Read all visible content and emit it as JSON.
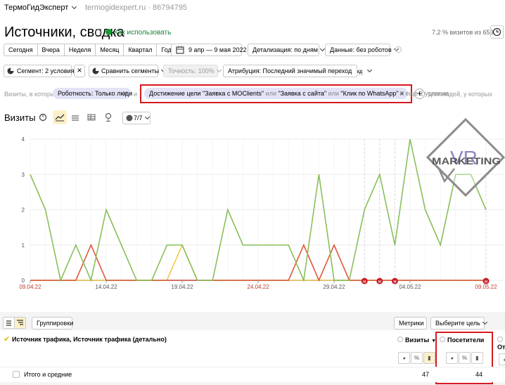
{
  "header": {
    "counter_name": "ТермоГидЭксперт",
    "counter_host": "termogidexpert.ru · 86794795",
    "title": "Источники, сводка",
    "howto": "Как использовать",
    "visit_share": "7,2 % визитов из 653"
  },
  "period": {
    "buttons": [
      "Сегодня",
      "Вчера",
      "Неделя",
      "Месяц",
      "Квартал",
      "Год"
    ],
    "range": "9 апр — 9 мая 2022",
    "detail": "Детализация: по дням",
    "data": "Данные: без роботов"
  },
  "segments": {
    "segment": "Сегмент: 2 условия",
    "compare": "Сравнить сегменты",
    "accuracy": "Точность: 100%",
    "attribution": "Атрибуция: Последний значимый переход",
    "attribution_badge": "кд"
  },
  "filters": {
    "visits_label": "Визиты, в которых",
    "robot_chip": "Роботность: Только люди",
    "and_label": "и",
    "goal_parts": [
      "Достижение цели \"Заявка с MOClients\"",
      " или ",
      "\"Заявка с сайта\"",
      " или ",
      "\"Клик по WhatsApp\"",
      " и еще 2 условия"
    ],
    "people_label": "для людей, у которых"
  },
  "chart_header": {
    "title": "Визиты",
    "series_count": "7/7"
  },
  "logo": {
    "line1": "VR",
    "line2": "MARKETING"
  },
  "chart_data": {
    "type": "line",
    "xlabel": "",
    "ylabel": "",
    "ylim": [
      0,
      4
    ],
    "y_ticks": [
      "0",
      "1",
      "2",
      "3",
      "4"
    ],
    "x_ticks": [
      {
        "label": "09.04.22",
        "index": 0,
        "red": true
      },
      {
        "label": "14.04.22",
        "index": 5,
        "red": false
      },
      {
        "label": "19.04.22",
        "index": 10,
        "red": false
      },
      {
        "label": "24.04.22",
        "index": 15,
        "red": true
      },
      {
        "label": "29.04.22",
        "index": 20,
        "red": false
      },
      {
        "label": "04.05.22",
        "index": 25,
        "red": false
      },
      {
        "label": "09.05.22",
        "index": 30,
        "red": true
      }
    ],
    "grid": true,
    "series": [
      {
        "color": "#88c05a",
        "values": [
          3,
          2,
          0,
          1,
          0,
          2,
          1,
          0,
          0,
          1,
          1,
          0,
          0,
          2,
          1,
          1,
          1,
          1,
          0,
          3,
          0,
          0,
          2,
          3,
          1,
          4,
          2,
          1,
          3,
          3,
          2
        ]
      },
      {
        "color": "#e0573a",
        "values": [
          0,
          0,
          0,
          0,
          1,
          0,
          0,
          0,
          0,
          0,
          0,
          0,
          0,
          0,
          0,
          0,
          0,
          0,
          1,
          0,
          1,
          0,
          0,
          0,
          0,
          0,
          0,
          0,
          0,
          0,
          0
        ]
      },
      {
        "color": "#f5c84a",
        "values": [
          0,
          0,
          0,
          0,
          0,
          0,
          0,
          0,
          0,
          0,
          1,
          0,
          0,
          0,
          0,
          0,
          0,
          0,
          0,
          0,
          0,
          0,
          0,
          0,
          0,
          0,
          0,
          0,
          0,
          0,
          0
        ]
      },
      {
        "color": "#4a90d9",
        "values": [
          0,
          0,
          0,
          0,
          0,
          0,
          0,
          0,
          0,
          0,
          0,
          0,
          0,
          0,
          0,
          0,
          0,
          0,
          0,
          0,
          0,
          0,
          0,
          0,
          0,
          0,
          0,
          0,
          0,
          0,
          0
        ]
      }
    ],
    "markers": [
      22,
      23,
      24,
      30
    ],
    "marker_glyph": "м"
  },
  "table": {
    "groupings": "Группировки",
    "metrics": "Метрики",
    "choose_goal": "Выберите цель",
    "dimension": "Источник трафика, Источник трафика (детально)",
    "col_visits": "Визиты",
    "col_visitors": "Посетители",
    "col_other": "От",
    "total_label": "Итого и средние",
    "total_visits": "47",
    "total_visitors": "44"
  }
}
